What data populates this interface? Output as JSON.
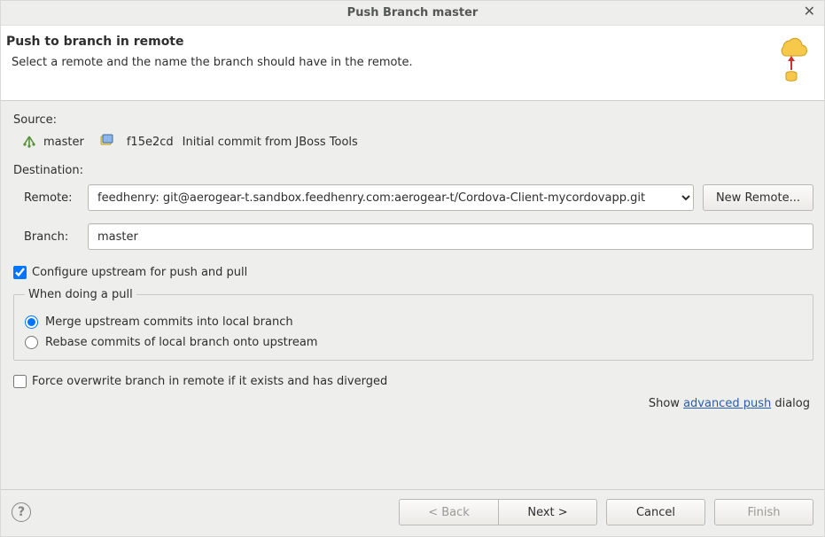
{
  "title": "Push Branch master",
  "header": {
    "title": "Push to branch in remote",
    "subtitle": "Select a remote and the name the branch should have in the remote."
  },
  "source": {
    "label": "Source:",
    "branch_name": "master",
    "commit_hash": "f15e2cd",
    "commit_msg": "Initial commit from JBoss Tools"
  },
  "destination": {
    "label": "Destination:",
    "remote_label": "Remote:",
    "remote_value": "feedhenry: git@aerogear-t.sandbox.feedhenry.com:aerogear-t/Cordova-Client-mycordovapp.git",
    "new_remote_btn": "New Remote...",
    "branch_label": "Branch:",
    "branch_value": "master"
  },
  "upstream": {
    "configure_label": "Configure upstream for push and pull",
    "configure_checked": true,
    "group_title": "When doing a pull",
    "merge_label": "Merge upstream commits into local branch",
    "rebase_label": "Rebase commits of local branch onto upstream",
    "selected": "merge"
  },
  "force": {
    "label": "Force overwrite branch in remote if it exists and has diverged",
    "checked": false
  },
  "advanced": {
    "prefix": "Show ",
    "link": "advanced push",
    "suffix": " dialog"
  },
  "footer": {
    "back": "< Back",
    "next": "Next >",
    "cancel": "Cancel",
    "finish": "Finish"
  }
}
